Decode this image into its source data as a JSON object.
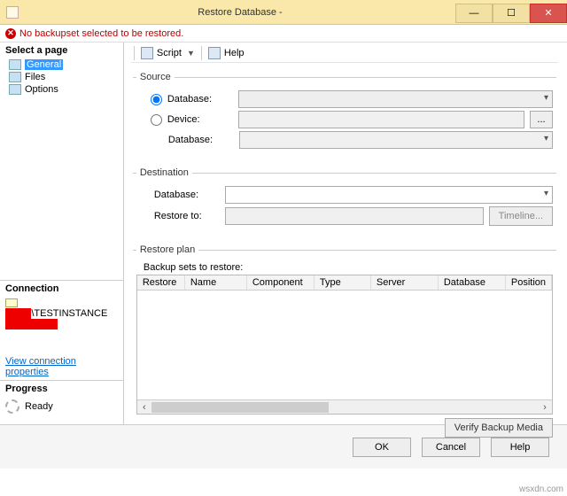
{
  "title": "Restore Database -",
  "error_msg": "No backupset selected to be restored.",
  "sidebar": {
    "select_page": "Select a page",
    "items": [
      "General",
      "Files",
      "Options"
    ],
    "connection_title": "Connection",
    "server_label": "\\TESTINSTANCE",
    "view_props": "View connection properties",
    "progress_title": "Progress",
    "progress_status": "Ready"
  },
  "toolbar": {
    "script": "Script",
    "help": "Help"
  },
  "source": {
    "legend": "Source",
    "database_radio": "Database:",
    "device_radio": "Device:",
    "database_label": "Database:",
    "ellipsis": "..."
  },
  "destination": {
    "legend": "Destination",
    "database_label": "Database:",
    "restore_to_label": "Restore to:",
    "timeline_btn": "Timeline..."
  },
  "restore_plan": {
    "legend": "Restore plan",
    "backup_sets_label": "Backup sets to restore:",
    "columns": [
      "Restore",
      "Name",
      "Component",
      "Type",
      "Server",
      "Database",
      "Position"
    ],
    "verify_btn": "Verify Backup Media"
  },
  "footer": {
    "ok": "OK",
    "cancel": "Cancel",
    "help": "Help"
  },
  "watermark_sub": "",
  "wsx": "wsxdn.com"
}
